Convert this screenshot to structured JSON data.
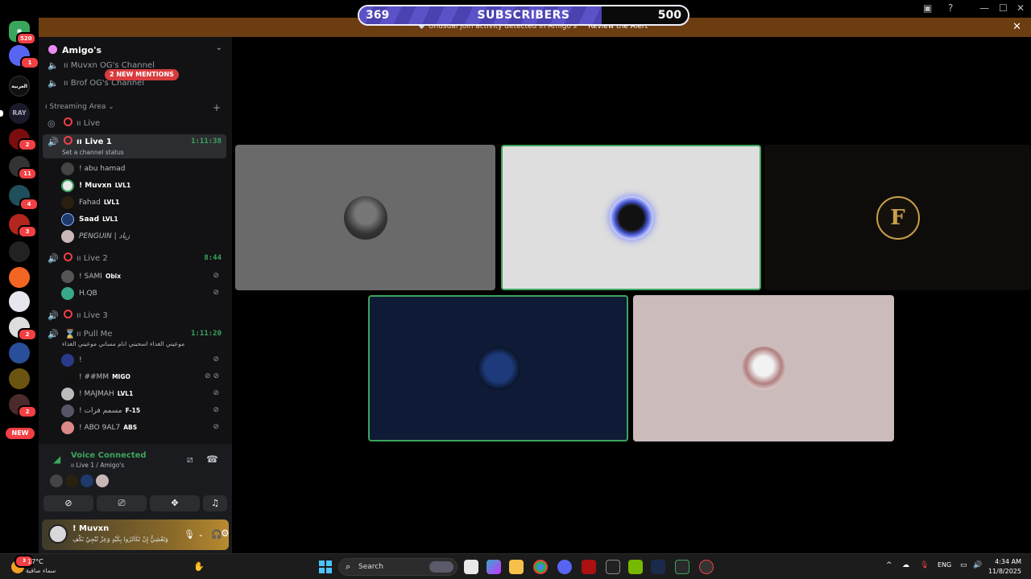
{
  "subscriber_goal": {
    "current": "369",
    "label": "SUBSCRIBERS",
    "goal": "500",
    "progress": 0.738
  },
  "alert": {
    "text": "Unusual join activity detected in Amigo's",
    "action": "Review the Alert"
  },
  "rail": {
    "home_badge": "520",
    "badges": [
      "1",
      "2",
      "11",
      "4",
      "3",
      "2",
      "2"
    ],
    "dm_label": "العربية",
    "ray_label": "RAY",
    "new_label": "NEW"
  },
  "guild": {
    "name": "Amigo's",
    "mentions_pill": "2 NEW MENTIONS"
  },
  "channels": {
    "top": [
      {
        "name": "ıı Muvxn OG's Channel"
      },
      {
        "name": "ıı Brof OG's Channel"
      }
    ],
    "category": "ı Streaming Area",
    "live": {
      "name": "ıı Live"
    },
    "live1": {
      "name": "ıı Live 1",
      "status": "Set a channel status",
      "time": "1:11:38"
    },
    "live1_members": [
      {
        "name": "! abu hamad",
        "tag": ""
      },
      {
        "name": "! Muvxn",
        "tag": "LVL1"
      },
      {
        "name": "Fahad",
        "tag": "LVL1"
      },
      {
        "name": "Saad",
        "tag": "LVL1"
      },
      {
        "name": "PENGUIN | زياد",
        "tag": ""
      }
    ],
    "live2": {
      "name": "ıı Live 2",
      "time": "8:44"
    },
    "live2_members": [
      {
        "name": "! SAMI",
        "tag": "Obix"
      },
      {
        "name": "H.QB",
        "tag": ""
      }
    ],
    "live3": {
      "name": "ıı Live 3"
    },
    "pullme": {
      "name": "ıı Pull Me",
      "status": "موعيني الغداء اسحبني انام مساني موعيني الغداء",
      "time": "1:11:20"
    },
    "pullme_members": [
      {
        "name": "!",
        "tag": ""
      },
      {
        "name": "! ##MM",
        "tag": "MIGO"
      },
      {
        "name": "! MAJMAH",
        "tag": "LVL1"
      },
      {
        "name": "! مسمم فرات",
        "tag": "F-15"
      },
      {
        "name": "! ABO 9AL7",
        "tag": "ABS"
      }
    ]
  },
  "voice": {
    "title": "Voice Connected",
    "sub": "ıı Live 1 / Amigo's"
  },
  "user": {
    "name": "! Muvxn",
    "status": "وَتَعْشِيُّ إِنْ تَكَاثَرُوا بِكَيْدٍ وَعِزْ تُنْجِيْ نَكْفِ"
  },
  "taskbar": {
    "temp": "17°C",
    "weather": "سماء صافية",
    "search_placeholder": "Search",
    "lang": "ENG",
    "time": "4:34 AM",
    "date": "11/8/2025",
    "weather_badge": "3"
  },
  "colors": {
    "speaking": "#3ba55d",
    "accent": "#5b52c8",
    "alert_bg": "#6b3d10",
    "live_ring": "#f23f43"
  }
}
